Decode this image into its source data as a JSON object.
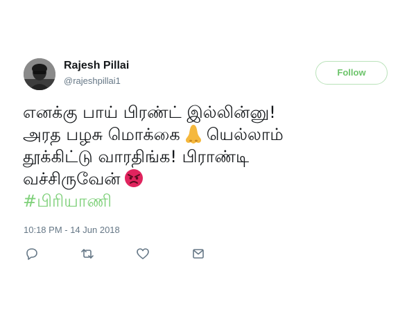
{
  "user": {
    "display_name": "Rajesh Pillai",
    "handle": "@rajeshpillai1",
    "avatar_icon": "profile-photo"
  },
  "follow_button": {
    "label": "Follow",
    "color": "#6cc46a"
  },
  "tweet": {
    "line1": "எனக்கு பாய் பிரண்ட் இல்லின்னு!",
    "line2_pre": "அரத பழசு மொக்கை",
    "line2_emoji": "nose-emoji",
    "line2_post": "யெல்லாம்",
    "line3": "தூக்கிட்டு வாரதிங்க! பிராண்டி",
    "line4": "வச்சிருவேன்",
    "line4_emoji": "angry-face-emoji",
    "hashtag": "#பிரியாணி",
    "hashtag_color": "#7ed079"
  },
  "timestamp": "10:18 PM - 14 Jun 2018",
  "actions": {
    "reply_icon": "reply-icon",
    "retweet_icon": "retweet-icon",
    "like_icon": "heart-icon",
    "dm_icon": "envelope-icon",
    "icon_color": "#657786"
  }
}
